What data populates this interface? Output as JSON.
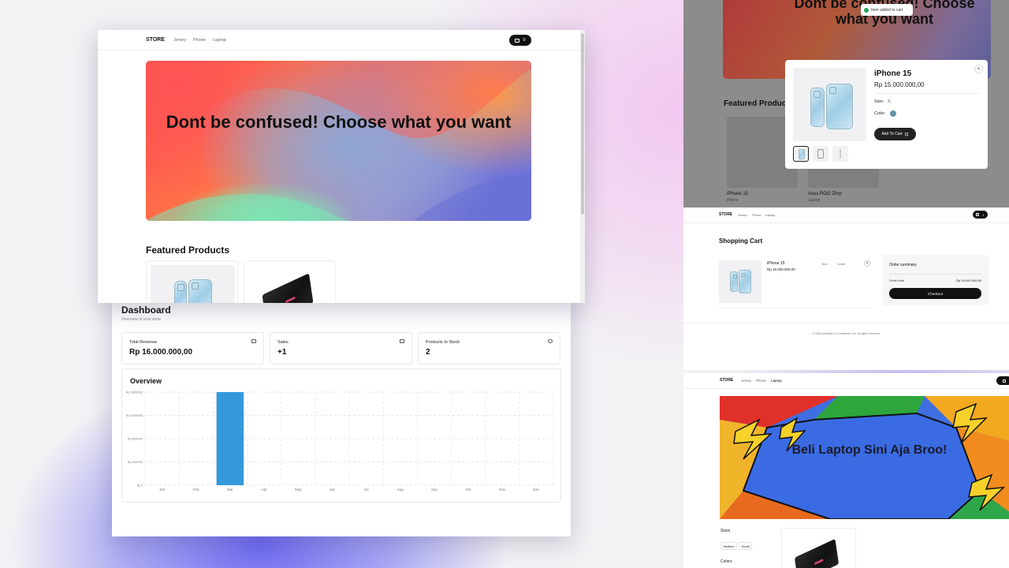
{
  "dashboard": {
    "title": "Dashboard",
    "subtitle": "Overview of your store",
    "stats": [
      {
        "label": "Total Revenue",
        "value": "Rp 16.000.000,00",
        "icon": "wallet-icon"
      },
      {
        "label": "Sales",
        "value": "+1",
        "icon": "credit-card-icon"
      },
      {
        "label": "Products In Stock",
        "value": "2",
        "icon": "package-icon"
      }
    ],
    "overview_title": "Overview"
  },
  "chart_data": {
    "type": "bar",
    "title": "Overview",
    "categories": [
      "Jan",
      "Feb",
      "Mar",
      "Apr",
      "May",
      "Jun",
      "Jul",
      "Aug",
      "Sep",
      "Oct",
      "Nov",
      "Dec"
    ],
    "values": [
      0,
      0,
      16000000,
      0,
      0,
      0,
      0,
      0,
      0,
      0,
      0,
      0
    ],
    "ytick_labels": [
      "Rp 0",
      "Rp 4000000",
      "Rp 8000000",
      "Rp 12000000",
      "Rp 16000000"
    ],
    "ylim": [
      0,
      16000000
    ],
    "grid": true,
    "color": "#3498db"
  },
  "store": {
    "brand": "STORE",
    "nav": [
      "Jersey",
      "Phone",
      "Laptop"
    ],
    "cart_count": "0",
    "hero_text": "Dont be confused! Choose what you want",
    "featured_title": "Featured Products"
  },
  "modal_view": {
    "bg_hero_text": "Dont be confused! Choose what you want",
    "bg_featured": "Featured Products",
    "bg_products": [
      {
        "name": "iPhone 15",
        "category": "Phone"
      },
      {
        "name": "Asus ROG Zhrp",
        "category": "Laptop"
      }
    ],
    "toast": "Item added to cart",
    "product": {
      "name": "iPhone 15",
      "price": "Rp 15.000.000,00",
      "size_label": "Size:",
      "size_value": "S",
      "color_label": "Color:",
      "color_hex": "#5f97a8",
      "add_button": "Add To Cart"
    }
  },
  "cart_view": {
    "brand": "STORE",
    "nav": [
      "Jersey",
      "Phone",
      "Laptop"
    ],
    "cart_count": "1",
    "title": "Shopping Cart",
    "item": {
      "name": "iPhone 15",
      "price": "Rp 16.000.000,00",
      "color": "Teal",
      "size": "Small"
    },
    "summary_title": "Order summary",
    "order_total_label": "Order total",
    "order_total_value": "Rp 16.000.000,00",
    "checkout": "Checkout",
    "footer": "© 2024 soultable.Co commerce, Inc. All rights reserved."
  },
  "laptop_view": {
    "brand": "STORE",
    "nav": [
      "Jersey",
      "Phone",
      "Laptop"
    ],
    "hero_text": "Beli Laptop Sini Aja Broo!",
    "sizes_label": "Sizes",
    "sizes": [
      "Medium",
      "Small"
    ],
    "colors_label": "Colors"
  }
}
